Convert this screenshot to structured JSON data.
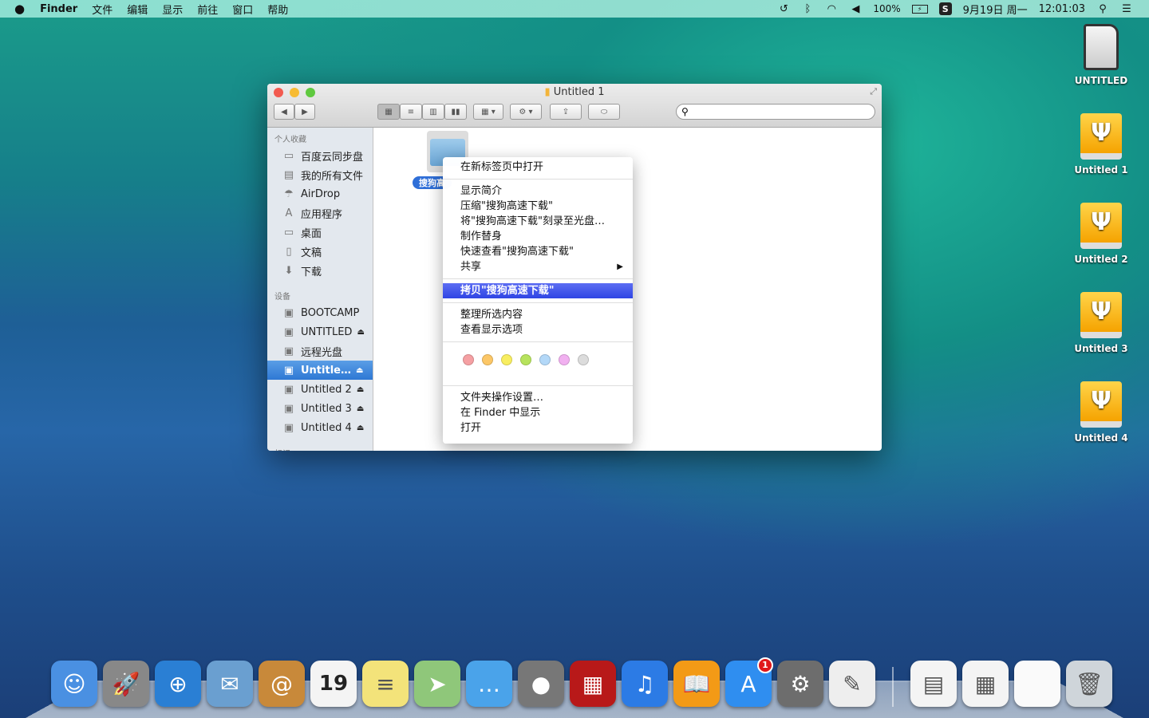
{
  "menubar": {
    "app": "Finder",
    "items": [
      "文件",
      "编辑",
      "显示",
      "前往",
      "窗口",
      "帮助"
    ],
    "battery": "100%",
    "date": "9月19日 周一",
    "time": "12:01:03",
    "sogou_icon": "S"
  },
  "desktop": [
    {
      "label": "UNTITLED",
      "icon": "sd-card-icon"
    },
    {
      "label": "Untitled 1",
      "icon": "usb-drive-icon"
    },
    {
      "label": "Untitled 2",
      "icon": "usb-drive-icon"
    },
    {
      "label": "Untitled 3",
      "icon": "usb-drive-icon"
    },
    {
      "label": "Untitled 4",
      "icon": "usb-drive-icon"
    }
  ],
  "window": {
    "title": "Untitled 1",
    "search_placeholder": ""
  },
  "sidebar": {
    "favorites_header": "个人收藏",
    "favorites": [
      {
        "label": "百度云同步盘",
        "icon": "▭"
      },
      {
        "label": "我的所有文件",
        "icon": "▤"
      },
      {
        "label": "AirDrop",
        "icon": "☂"
      },
      {
        "label": "应用程序",
        "icon": "A"
      },
      {
        "label": "桌面",
        "icon": "▭"
      },
      {
        "label": "文稿",
        "icon": "▯"
      },
      {
        "label": "下载",
        "icon": "⬇"
      }
    ],
    "devices_header": "设备",
    "devices": [
      {
        "label": "BOOTCAMP",
        "eject": false
      },
      {
        "label": "UNTITLED",
        "eject": true
      },
      {
        "label": "远程光盘",
        "eject": false
      },
      {
        "label": "Untitle…",
        "eject": true,
        "selected": true
      },
      {
        "label": "Untitled 2",
        "eject": true
      },
      {
        "label": "Untitled 3",
        "eject": true
      },
      {
        "label": "Untitled 4",
        "eject": true
      }
    ],
    "tags_header": "标记"
  },
  "content": {
    "folder_label": "搜狗高"
  },
  "context_menu": {
    "groups": [
      [
        "在新标签页中打开"
      ],
      [
        "显示简介",
        "压缩\"搜狗高速下载\"",
        "将\"搜狗高速下载\"刻录至光盘…",
        "制作替身",
        "快速查看\"搜狗高速下载\"",
        "共享"
      ],
      [
        "拷贝\"搜狗高速下载\""
      ],
      [
        "整理所选内容",
        "查看显示选项"
      ]
    ],
    "tag_colors": [
      "#f5a0a3",
      "#fcc767",
      "#f8ee60",
      "#b7e35d",
      "#b3d8f8",
      "#f1b0f0",
      "#dcdcdc"
    ],
    "footer": [
      "文件夹操作设置…",
      "在 Finder 中显示",
      "打开"
    ]
  },
  "dock": {
    "calendar_day": "19",
    "app_store_badge": "1",
    "apps": [
      {
        "name": "finder",
        "color": "#4a90e2",
        "g": "☺"
      },
      {
        "name": "launchpad",
        "color": "#888",
        "g": "🚀"
      },
      {
        "name": "safari",
        "color": "#2a7fd4",
        "g": "⊕"
      },
      {
        "name": "mail",
        "color": "#6a9fd0",
        "g": "✉"
      },
      {
        "name": "contacts",
        "color": "#c8893a",
        "g": "@"
      },
      {
        "name": "calendar",
        "color": "#f4f4f4",
        "g": ""
      },
      {
        "name": "notes",
        "color": "#f3e37a",
        "g": "≡"
      },
      {
        "name": "maps",
        "color": "#8fc77a",
        "g": "➤"
      },
      {
        "name": "messages",
        "color": "#4aa3ea",
        "g": "…"
      },
      {
        "name": "facetime",
        "color": "#777",
        "g": "●"
      },
      {
        "name": "photo-booth",
        "color": "#b81919",
        "g": "▦"
      },
      {
        "name": "itunes",
        "color": "#2c7be5",
        "g": "♫"
      },
      {
        "name": "ibooks",
        "color": "#f39a16",
        "g": "📖"
      },
      {
        "name": "app-store",
        "color": "#2f8ef0",
        "g": "A"
      },
      {
        "name": "system-preferences",
        "color": "#6d6d6d",
        "g": "⚙"
      },
      {
        "name": "textedit",
        "color": "#eee",
        "g": "✎"
      }
    ],
    "others": [
      {
        "name": "documents-stack",
        "color": "#f4f4f4",
        "g": "▤"
      },
      {
        "name": "screenshots-stack",
        "color": "#f4f4f4",
        "g": "▦"
      },
      {
        "name": "downloads-stack",
        "color": "#fafafa",
        "g": ""
      },
      {
        "name": "trash",
        "color": "#cfd5da",
        "g": "🗑"
      }
    ]
  }
}
